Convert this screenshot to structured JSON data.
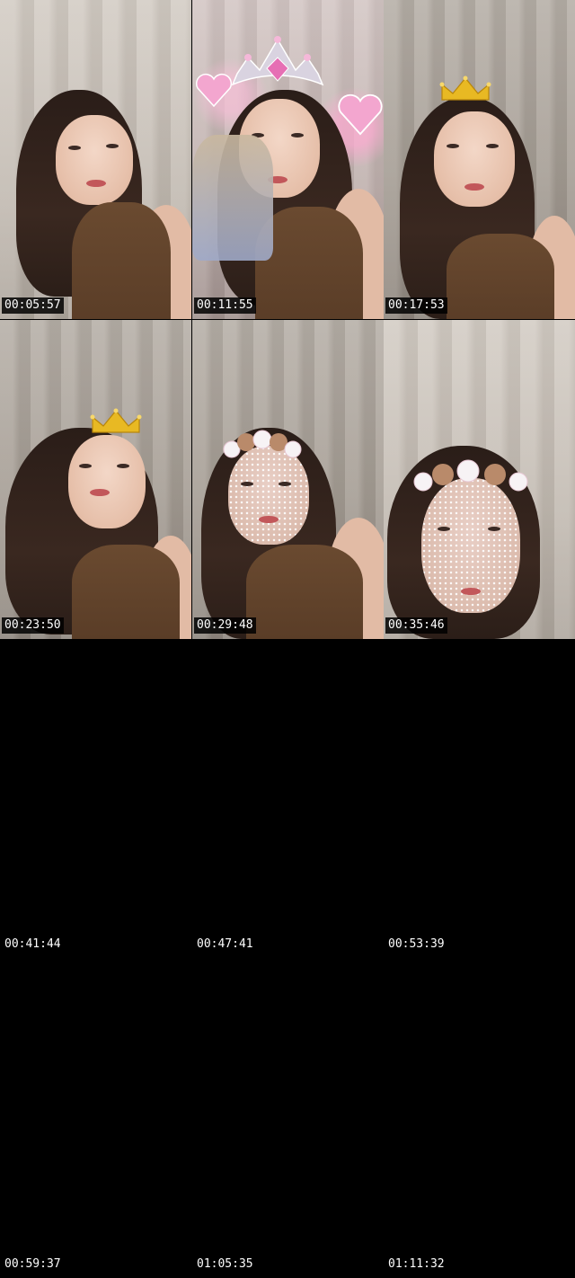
{
  "thumbnails": [
    {
      "timestamp": "00:05:57",
      "has_image": true
    },
    {
      "timestamp": "00:11:55",
      "has_image": true
    },
    {
      "timestamp": "00:17:53",
      "has_image": true
    },
    {
      "timestamp": "00:23:50",
      "has_image": true
    },
    {
      "timestamp": "00:29:48",
      "has_image": true
    },
    {
      "timestamp": "00:35:46",
      "has_image": true
    },
    {
      "timestamp": "00:41:44",
      "has_image": false
    },
    {
      "timestamp": "00:47:41",
      "has_image": false
    },
    {
      "timestamp": "00:53:39",
      "has_image": false
    },
    {
      "timestamp": "00:59:37",
      "has_image": false
    },
    {
      "timestamp": "01:05:35",
      "has_image": false
    },
    {
      "timestamp": "01:11:32",
      "has_image": false
    }
  ],
  "colors": {
    "background": "#000000",
    "timestamp_text": "#ffffff",
    "crown_gold": "#e8b923",
    "gem_pink": "#f3a6cf"
  },
  "icons": {
    "crown": "crown-icon",
    "tiara": "tiara-icon",
    "heart_gem": "heart-gem-icon",
    "bear_headband": "bear-headband-icon"
  }
}
